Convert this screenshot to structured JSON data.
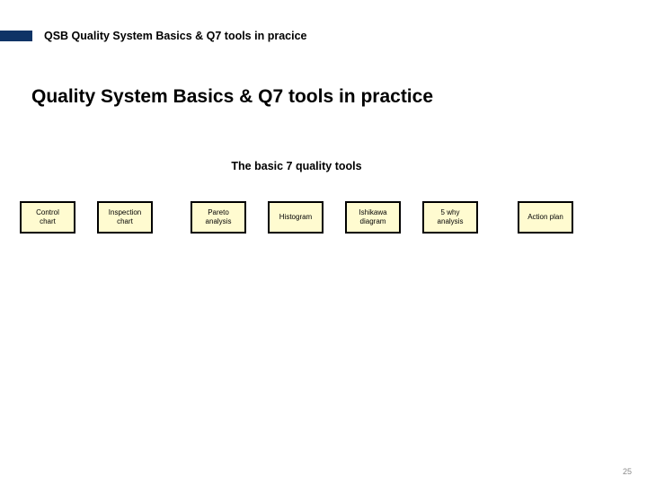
{
  "header": {
    "title": "QSB Quality System Basics & Q7 tools in pracice",
    "accent_color": "#0e3366"
  },
  "page_title": "Quality System Basics & Q7 tools in practice",
  "subtitle": "The basic 7 quality tools",
  "tools": [
    {
      "label": "Control\nchart"
    },
    {
      "label": "Inspection\nchart"
    },
    {
      "label": "Pareto\nanalysis"
    },
    {
      "label": "Histogram"
    },
    {
      "label": "Ishikawa\ndiagram"
    },
    {
      "label": "5 why\nanalysis"
    },
    {
      "label": "Action plan"
    }
  ],
  "box_fill_color": "#fffbd0",
  "page_number": "25"
}
